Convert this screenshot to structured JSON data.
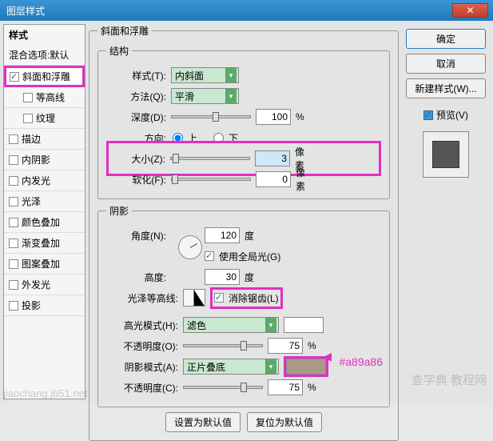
{
  "title": "图层样式",
  "styles": {
    "header": "样式",
    "blend": "混合选项:默认",
    "bevel": "斜面和浮雕",
    "contour": "等高线",
    "texture": "纹理",
    "stroke": "描边",
    "innerShadow": "内阴影",
    "innerGlow": "内发光",
    "satin": "光泽",
    "colorOverlay": "颜色叠加",
    "gradOverlay": "渐变叠加",
    "patternOverlay": "图案叠加",
    "outerGlow": "外发光",
    "dropShadow": "投影"
  },
  "bevel": {
    "groupTitle": "斜面和浮雕",
    "structure": "结构",
    "styleLabel": "样式(T):",
    "styleValue": "内斜面",
    "techLabel": "方法(Q):",
    "techValue": "平滑",
    "depthLabel": "深度(D):",
    "depthValue": "100",
    "percent": "%",
    "dirLabel": "方向:",
    "up": "上",
    "down": "下",
    "sizeLabel": "大小(Z):",
    "sizeValue": "3",
    "px": "像素",
    "softenLabel": "软化(F):",
    "softenValue": "0"
  },
  "shading": {
    "group": "阴影",
    "angleLabel": "角度(N):",
    "angleValue": "120",
    "deg": "度",
    "globalLight": "使用全局光(G)",
    "altLabel": "高度:",
    "altValue": "30",
    "glossLabel": "光泽等高线:",
    "antialias": "消除锯齿(L)",
    "hlModeLabel": "高光模式(H):",
    "hlModeValue": "滤色",
    "hlOpacityLabel": "不透明度(O):",
    "hlOpacity": "75",
    "shModeLabel": "阴影模式(A):",
    "shModeValue": "正片叠底",
    "shOpacityLabel": "不透明度(C):",
    "shOpacity": "75",
    "shadowColor": "#a89a86",
    "hexLabel": "#a89a86"
  },
  "bottomBtns": {
    "default": "设置为默认值",
    "reset": "复位为默认值"
  },
  "right": {
    "ok": "确定",
    "cancel": "取消",
    "newStyle": "新建样式(W)...",
    "preview": "预览(V)"
  },
  "watermark": "jiaochang.jb51.net",
  "watermark2": "查字典 教程网"
}
